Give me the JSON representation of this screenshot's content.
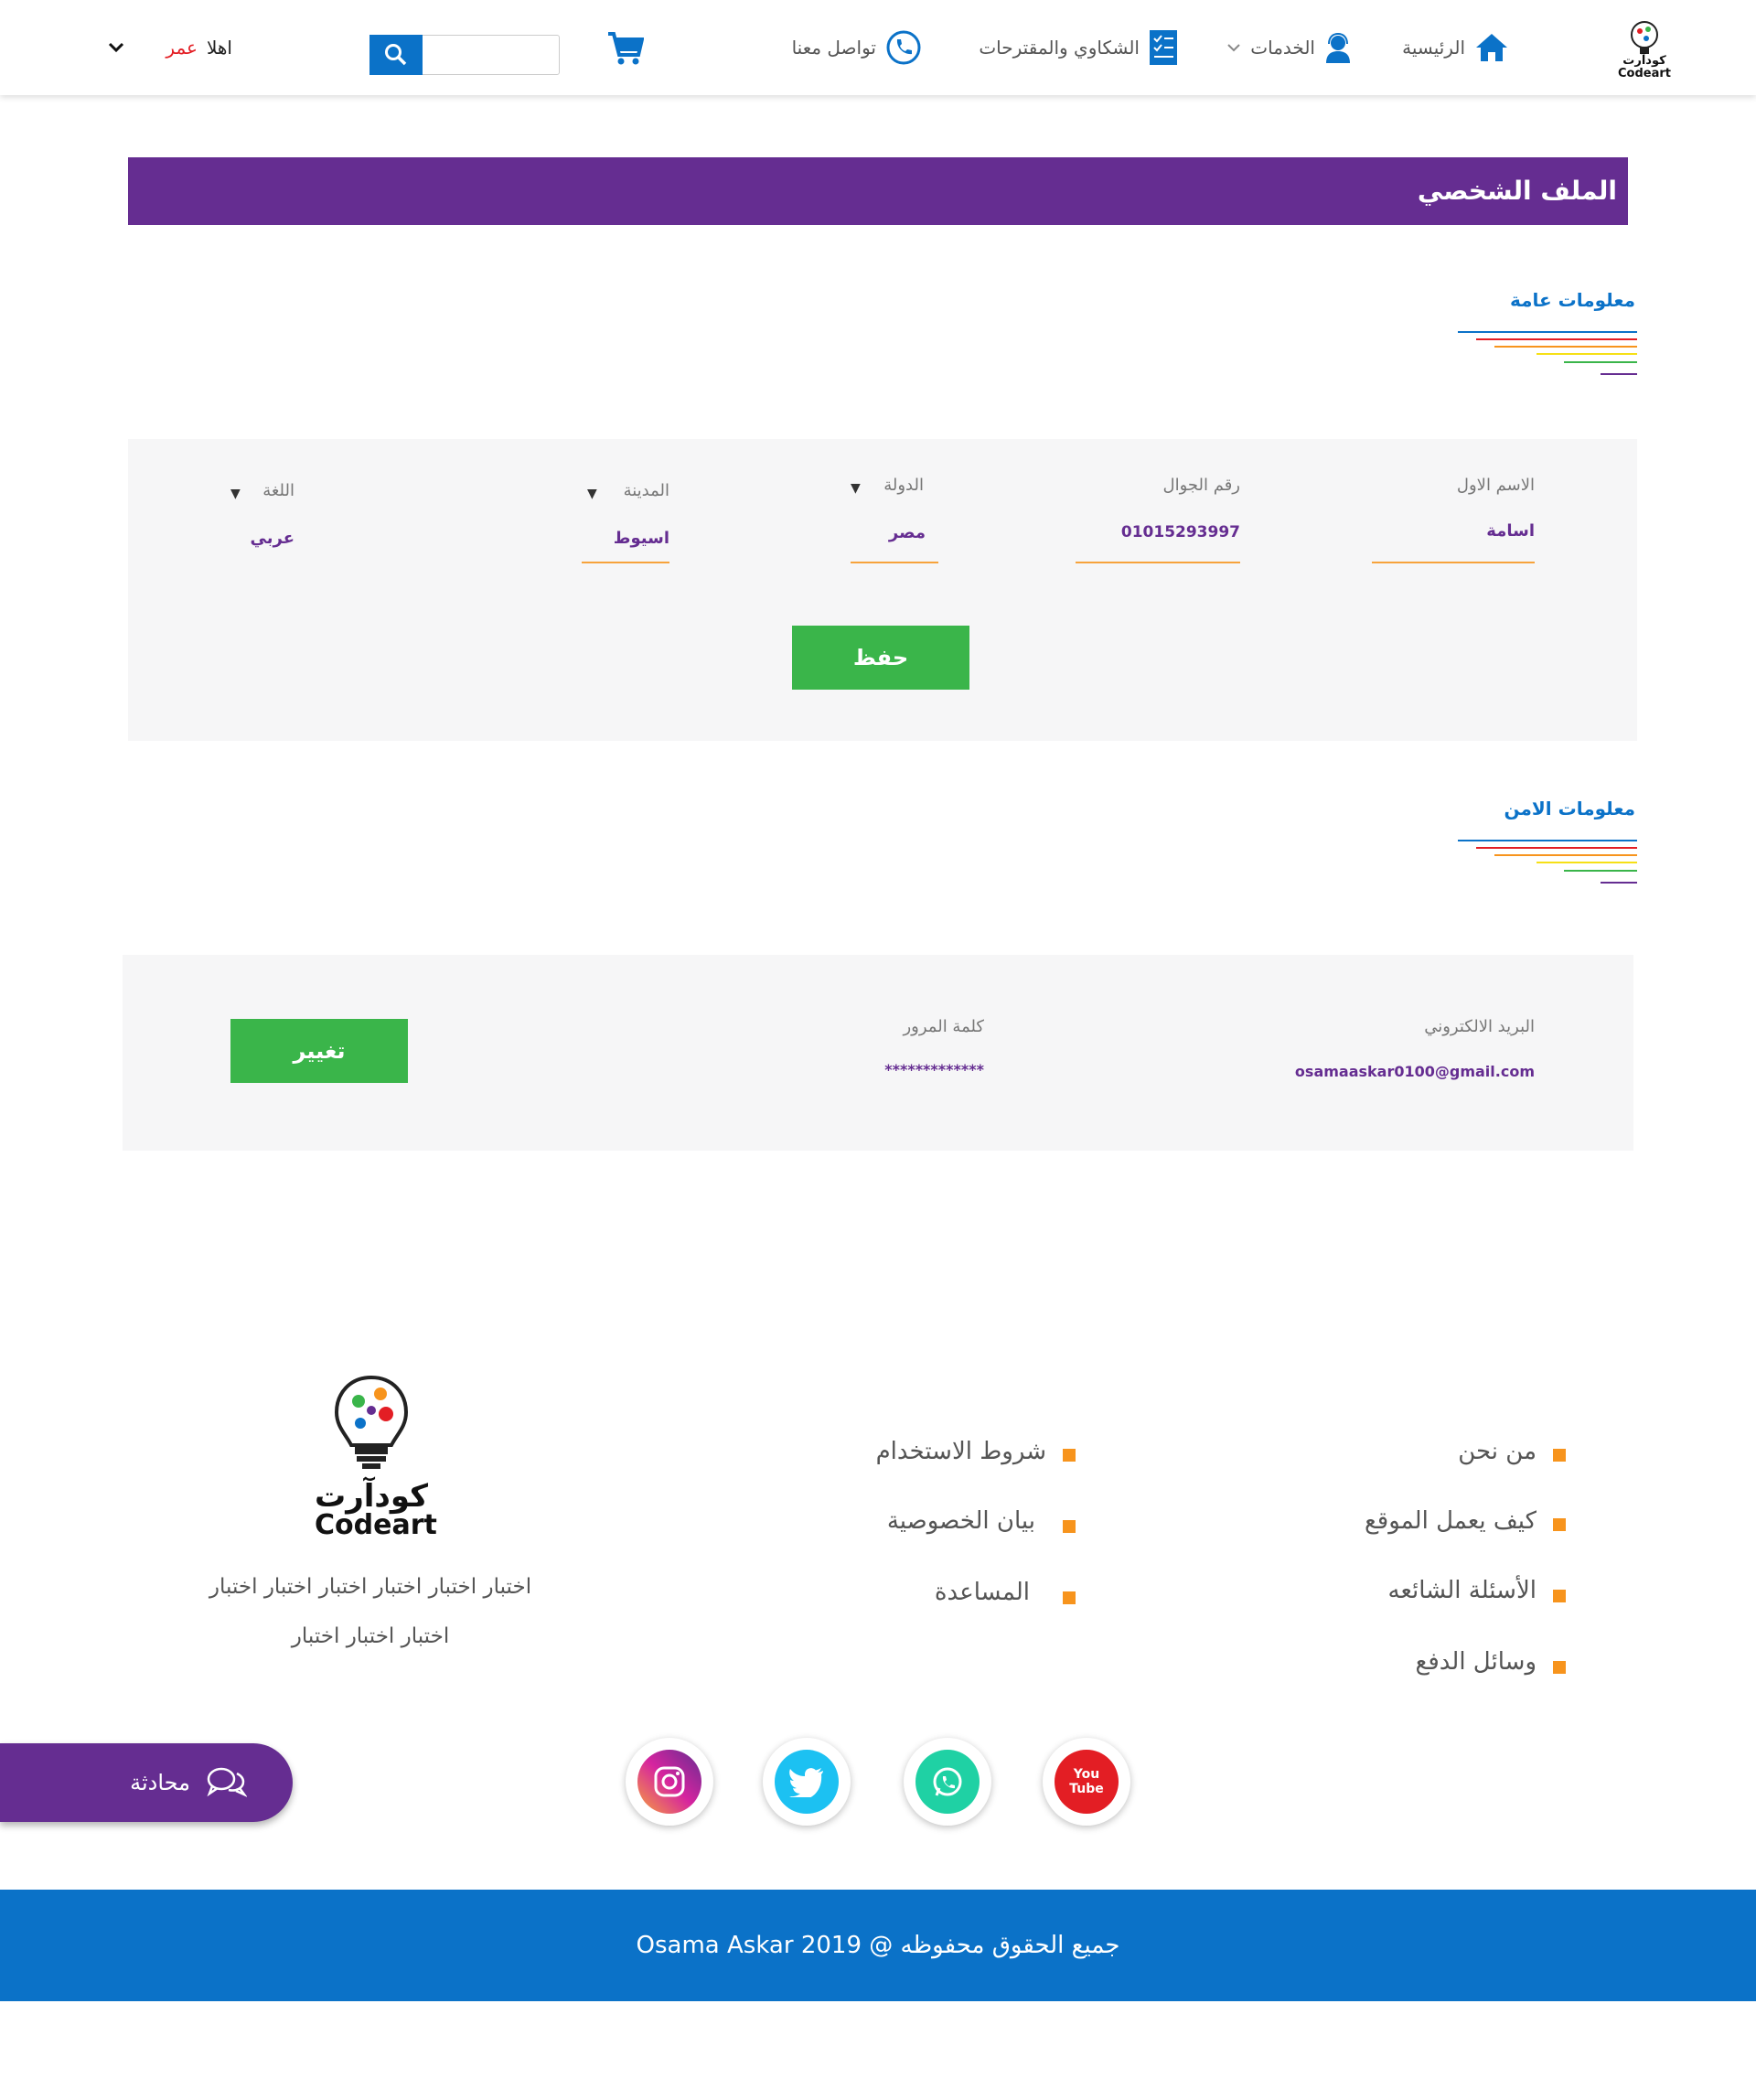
{
  "header": {
    "logo_ar": "كودآرت",
    "logo_en": "Codeart",
    "nav": {
      "home": "الرئيسية",
      "services": "الخدمات",
      "complaints": "الشكاوي والمقترحات",
      "contact": "تواصل معنا"
    },
    "search_placeholder": "",
    "greeting": "اهلا",
    "user_name": "عمر"
  },
  "page_title": "الملف الشخصي",
  "general": {
    "heading": "معلومات عامة",
    "first_name_label": "الاسم الاول",
    "first_name_value": "اسامة",
    "phone_label": "رقم الجوال",
    "phone_value": "01015293997",
    "country_label": "الدولة",
    "country_value": "مصر",
    "city_label": "المدينة",
    "city_value": "اسيوط",
    "language_label": "اللغة",
    "language_value": "عربي",
    "save_label": "حفظ"
  },
  "security": {
    "heading": "معلومات الامن",
    "email_label": "البريد الالكتروني",
    "email_value": "osamaaskar0100@gmail.com",
    "password_label": "كلمة المرور",
    "password_value": "*************",
    "change_label": "تغيير"
  },
  "footer": {
    "col1": [
      "من نحن",
      "كيف يعمل الموقع",
      "الأسئلة الشائعه",
      "وسائل الدفع"
    ],
    "col2": [
      "شروط الاستخدام",
      "بيان الخصوصية",
      "المساعدة"
    ],
    "logo_ar": "كودآرت",
    "logo_en": "Codeart",
    "about_line1": "اختبار اختبار اختبار اختبار اختبار اختبار",
    "about_line2": "اختبار اختبار اختبار",
    "social": [
      "youtube-icon",
      "whatsapp-icon",
      "twitter-icon",
      "instagram-icon"
    ],
    "youtube_text": "You Tube",
    "copyright": "جميع الحقوق محفوظه @  2019  Osama Askar"
  },
  "chat": {
    "label": "محادثة"
  },
  "colors": {
    "primary_purple": "#652d91",
    "primary_blue": "#0b72c8",
    "green": "#3ab54a",
    "orange": "#f7941d",
    "red_name": "#e31e24"
  }
}
